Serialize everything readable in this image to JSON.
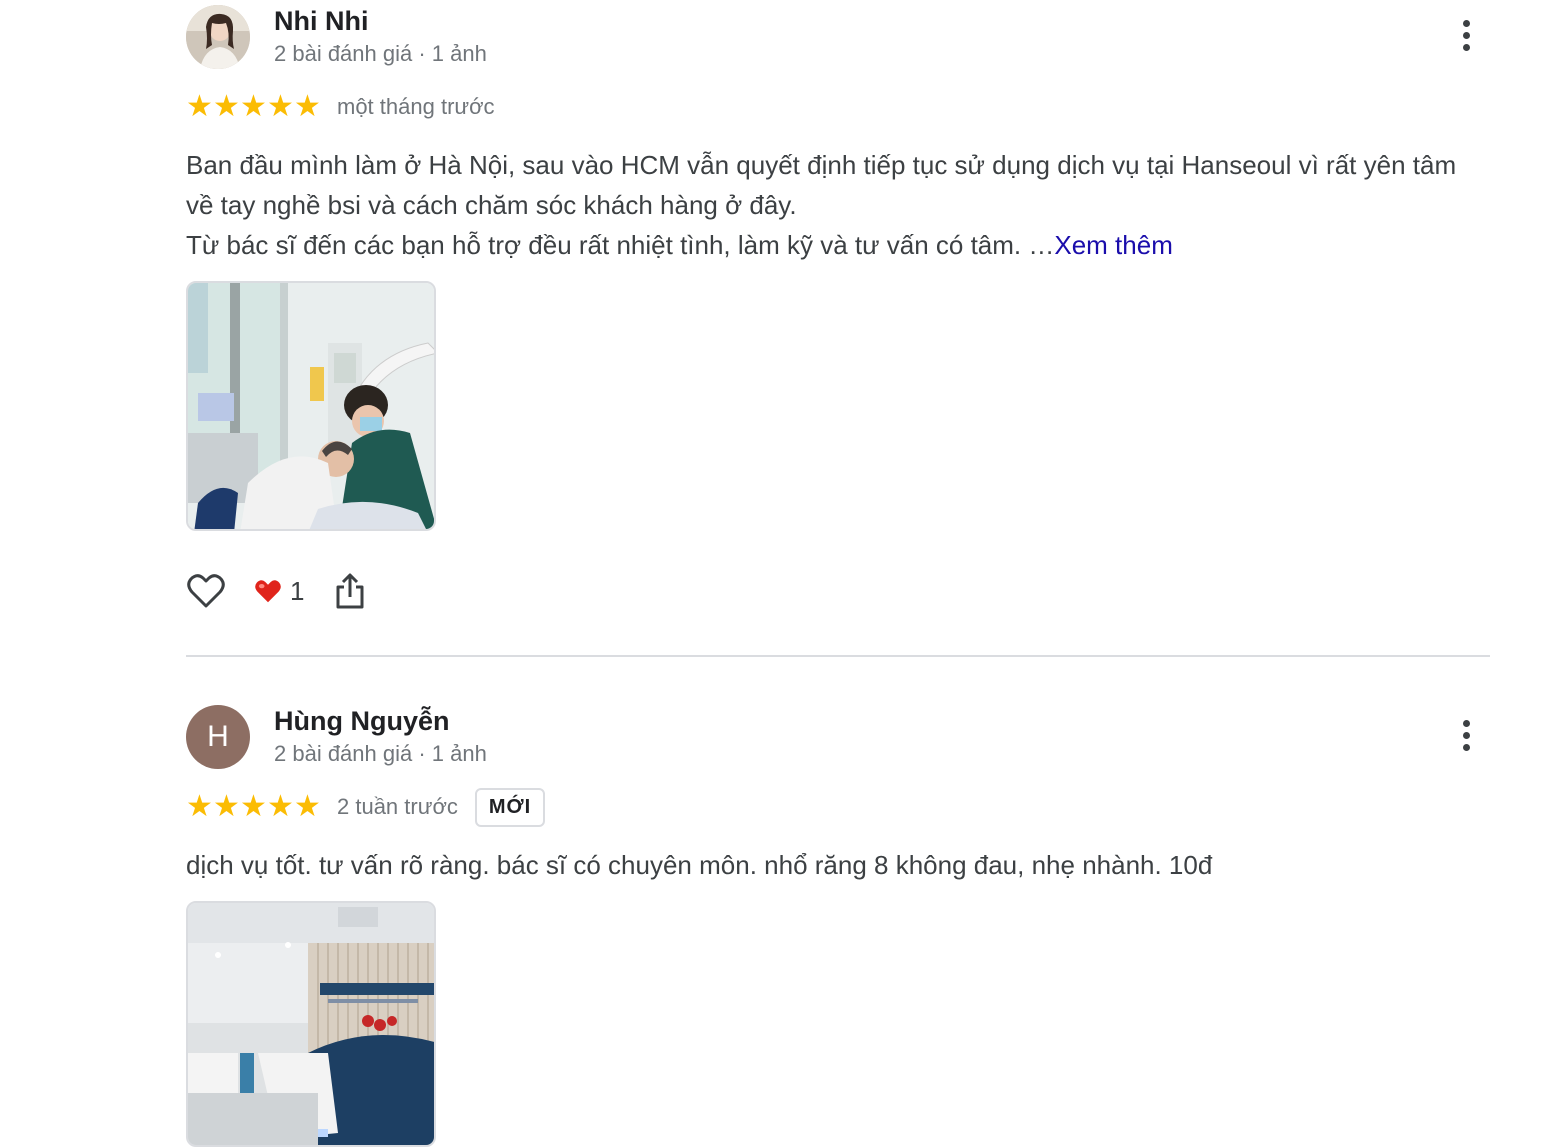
{
  "reviews": [
    {
      "author": "Nhi Nhi",
      "meta": "2 bài đánh giá · 1 ảnh",
      "rating": 5,
      "date": "một tháng trước",
      "text_lines": [
        "Ban đầu mình làm ở Hà Nội, sau vào HCM vẫn quyết định tiếp tục sử dụng dịch vụ tại Hanseoul vì rất yên tâm về tay nghề bsi và cách chăm sóc khách hàng ở đây.",
        "Từ bác sĩ đến các bạn hỗ trợ đều rất nhiệt tình, làm kỹ và tư vấn có tâm. …"
      ],
      "more_link": "Xem thêm",
      "reaction_count": "1"
    },
    {
      "author": "Hùng Nguyễn",
      "avatar_letter": "H",
      "meta": "2 bài đánh giá · 1 ảnh",
      "rating": 5,
      "date": "2 tuần trước",
      "badge": "MỚI",
      "text": "dịch vụ tốt. tư vấn rõ ràng. bác sĩ có chuyên môn. nhổ răng 8 không đau, nhẹ nhành. 10đ"
    }
  ],
  "colors": {
    "star": "#fbbc04",
    "link": "#1a0dab",
    "avatar_h": "#8d6e63",
    "heart": "#e0241b"
  }
}
